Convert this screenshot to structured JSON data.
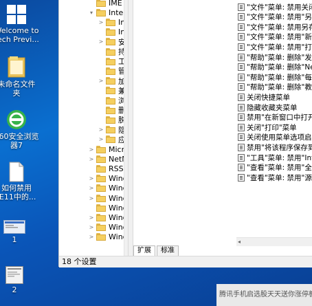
{
  "desktop": {
    "icons": [
      {
        "name": "welcome-icon",
        "label": "Welcome to\nTech Previ..."
      },
      {
        "name": "folder-icon",
        "label": "未命名文件\n夹"
      },
      {
        "name": "browser-360-icon",
        "label": "360安全浏览\n器7"
      },
      {
        "name": "document-icon",
        "label": "如何禁用\nIE11中的..."
      },
      {
        "name": "screenshot-1-icon",
        "label": "1"
      },
      {
        "name": "screenshot-2-icon",
        "label": "2"
      }
    ]
  },
  "tree": {
    "items": [
      {
        "label": "IME",
        "expander": "",
        "level": 1
      },
      {
        "label": "Interne",
        "expander": "▾",
        "level": 1
      },
      {
        "label": "Int",
        "expander": ">",
        "level": 2
      },
      {
        "label": "Int",
        "expander": "",
        "level": 2
      },
      {
        "label": "安",
        "expander": ">",
        "level": 2
      },
      {
        "label": "持",
        "expander": "",
        "level": 2
      },
      {
        "label": "工",
        "expander": "",
        "level": 2
      },
      {
        "label": "管",
        "expander": "",
        "level": 2
      },
      {
        "label": "加",
        "expander": ">",
        "level": 2
      },
      {
        "label": "兼",
        "expander": "",
        "level": 2
      },
      {
        "label": "浏",
        "expander": "",
        "level": 2
      },
      {
        "label": "删",
        "expander": "",
        "level": 2
      },
      {
        "label": "脱",
        "expander": "",
        "level": 2
      },
      {
        "label": "隐",
        "expander": ">",
        "level": 2
      },
      {
        "label": "应",
        "expander": ">",
        "level": 2
      },
      {
        "label": "Micro",
        "expander": ">",
        "level": 1
      },
      {
        "label": "NetM",
        "expander": ">",
        "level": 1
      },
      {
        "label": "RSS 源",
        "expander": "",
        "level": 1
      },
      {
        "label": "Windo",
        "expander": ">",
        "level": 1
      },
      {
        "label": "Windo",
        "expander": ">",
        "level": 1
      },
      {
        "label": "Windo",
        "expander": ">",
        "level": 1
      },
      {
        "label": "Windo",
        "expander": "",
        "level": 1
      },
      {
        "label": "Windo",
        "expander": ">",
        "level": 1
      },
      {
        "label": "Windo",
        "expander": ">",
        "level": 1
      },
      {
        "label": "Windo",
        "expander": ">",
        "level": 1
      }
    ]
  },
  "policies": [
    "\"文件\"菜单: 禁用关闭浏览",
    "\"文件\"菜单: 禁用\"另存为...",
    "\"文件\"菜单: 禁用另存为\"网",
    "\"文件\"菜单: 禁用\"新建\"菜",
    "\"文件\"菜单: 禁用\"打开\"菜",
    "\"帮助\"菜单: 删除\"发送反馈",
    "\"帮助\"菜单: 删除\"Netsca",
    "\"帮助\"菜单: 删除\"每日提示",
    "\"帮助\"菜单: 删除\"教程\"菜",
    "关闭快捷菜单",
    "隐藏收藏夹菜单",
    "禁用\"在新窗口中打开\"菜单",
    "关闭\"打印\"菜单",
    "关闭使用菜单选项启动\"报",
    "禁用\"将该程序保存到磁盘",
    "\"工具\"菜单: 禁用\"Interne",
    "\"查看\"菜单: 禁用\"全屏显示",
    "\"查看\"菜单: 禁用\"源文件\""
  ],
  "tabs": {
    "extended": "扩展",
    "standard": "标准"
  },
  "status": {
    "text": "18 个设置"
  },
  "notification": {
    "text": "腾讯手机启选股天天送你涨停板"
  },
  "colors": {
    "desktop": "#0a6fd0",
    "window": "#ffffff",
    "status": "#f0f0f0"
  }
}
